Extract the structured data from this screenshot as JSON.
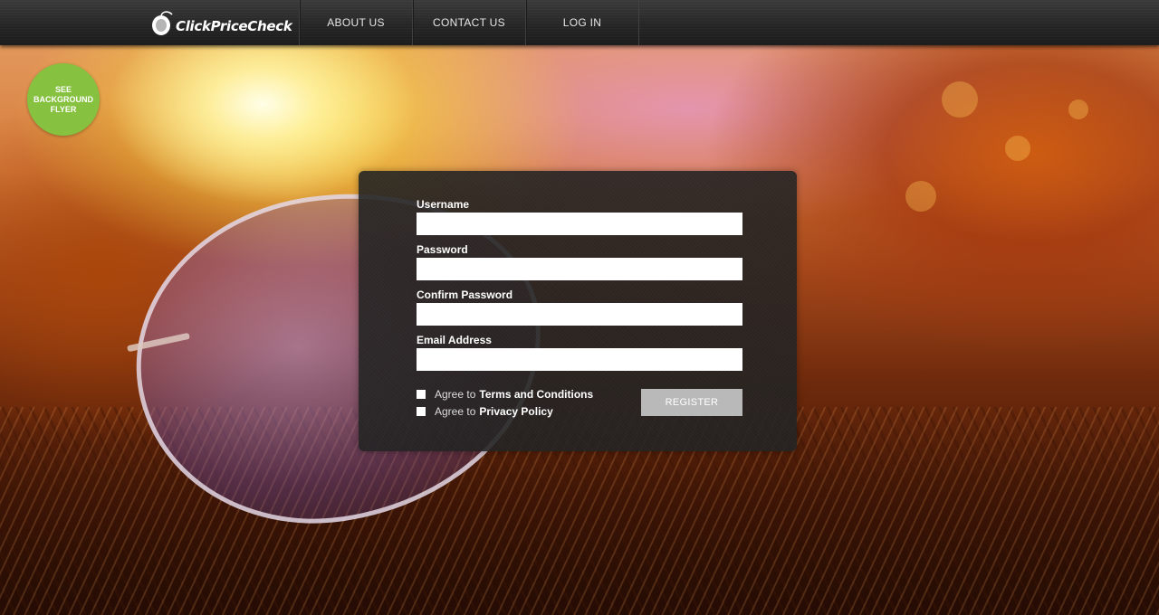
{
  "header": {
    "logo_text": "ClickPriceCheck",
    "nav": [
      {
        "label": "ABOUT US"
      },
      {
        "label": "CONTACT US"
      },
      {
        "label": "LOG IN"
      }
    ]
  },
  "flyer_badge": {
    "lines": [
      "SEE",
      "BACKGROUND",
      "FLYER"
    ],
    "color": "#86c140"
  },
  "register_form": {
    "fields": [
      {
        "label": "Username",
        "value": ""
      },
      {
        "label": "Password",
        "value": ""
      },
      {
        "label": "Confirm Password",
        "value": ""
      },
      {
        "label": "Email Address",
        "value": ""
      }
    ],
    "agreements": [
      {
        "prefix": "Agree to",
        "link": "Terms and Conditions",
        "checked": false
      },
      {
        "prefix": "Agree to",
        "link": "Privacy Policy",
        "checked": false
      }
    ],
    "submit_label": "REGISTER"
  },
  "colors": {
    "topbar": "#262626",
    "panel": "#222222",
    "register_button": "#b9b9b9",
    "badge": "#86c140"
  }
}
